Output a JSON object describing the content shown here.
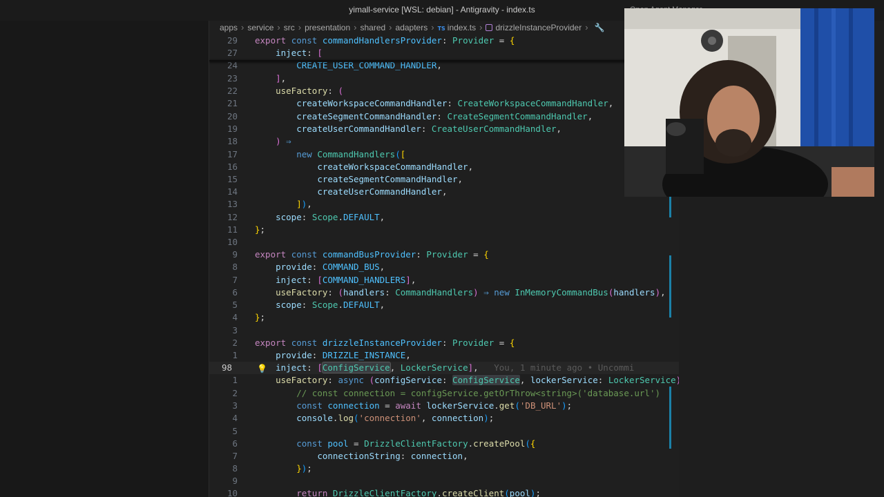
{
  "window": {
    "title": "yimall-service [WSL: debian] - Antigravity - index.ts",
    "right_text": "Open Agent Manager"
  },
  "breadcrumb": {
    "items": [
      "apps",
      "service",
      "src",
      "presentation",
      "shared",
      "adapters"
    ],
    "file": "index.ts",
    "file_icon": "TS",
    "symbol": "drizzleInstanceProvider"
  },
  "editor": {
    "line_numbers": [
      "29",
      "27",
      "24",
      "23",
      "22",
      "21",
      "20",
      "19",
      "18",
      "17",
      "16",
      "15",
      "14",
      "13",
      "12",
      "11",
      "10",
      "9",
      "8",
      "7",
      "6",
      "5",
      "4",
      "3",
      "2",
      "1",
      "98",
      "1",
      "2",
      "3",
      "4",
      "5",
      "6",
      "7",
      "8",
      "9",
      "10"
    ],
    "current_line_number": "98",
    "blame": "You, 1 minute ago • Uncommi"
  }
}
